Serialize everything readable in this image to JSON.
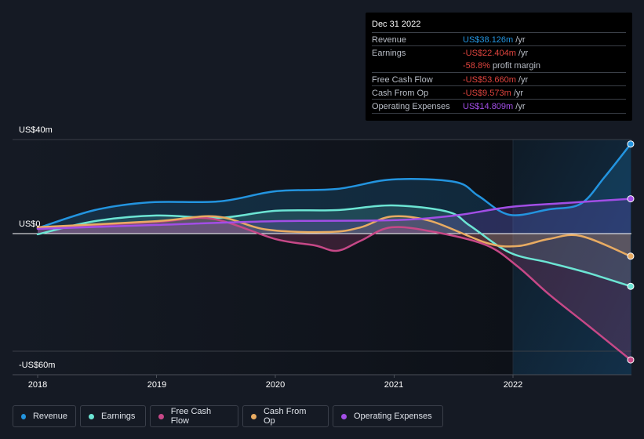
{
  "tooltip": {
    "date": "Dec 31 2022",
    "rows": [
      {
        "label": "Revenue",
        "value": "US$38.126m",
        "unit": " /yr",
        "color": "#2394df"
      },
      {
        "label": "Earnings",
        "value": "-US$22.404m",
        "unit": " /yr",
        "color": "#e0443e"
      },
      {
        "label": "",
        "value": "-58.8%",
        "unit": " profit margin",
        "color": "#e0443e"
      },
      {
        "label": "Free Cash Flow",
        "value": "-US$53.660m",
        "unit": " /yr",
        "color": "#e0443e"
      },
      {
        "label": "Cash From Op",
        "value": "-US$9.573m",
        "unit": " /yr",
        "color": "#e0443e"
      },
      {
        "label": "Operating Expenses",
        "value": "US$14.809m",
        "unit": " /yr",
        "color": "#a24ee6"
      }
    ]
  },
  "legend": [
    {
      "label": "Revenue",
      "color": "#2394df"
    },
    {
      "label": "Earnings",
      "color": "#6ce5d4"
    },
    {
      "label": "Free Cash Flow",
      "color": "#c64887"
    },
    {
      "label": "Cash From Op",
      "color": "#e8ab62"
    },
    {
      "label": "Operating Expenses",
      "color": "#a24ee6"
    }
  ],
  "chart_data": {
    "type": "line",
    "title": "",
    "xlabel": "",
    "ylabel": "",
    "y_tick_labels": [
      "US$40m",
      "US$0",
      "-US$60m"
    ],
    "x_tick_labels": [
      "2018",
      "2019",
      "2020",
      "2021",
      "2022"
    ],
    "xlim": [
      2017.8,
      2023.0
    ],
    "ylim": [
      -60,
      40
    ],
    "unit": "US$m",
    "highlight_range_start": 2022.0,
    "series": [
      {
        "name": "Revenue",
        "color": "#2394df",
        "points": [
          [
            2018.0,
            2.3
          ],
          [
            2018.48,
            10
          ],
          [
            2018.94,
            13.3
          ],
          [
            2019.53,
            13.7
          ],
          [
            2020.0,
            18
          ],
          [
            2020.52,
            19
          ],
          [
            2020.98,
            23
          ],
          [
            2021.51,
            22
          ],
          [
            2021.71,
            16
          ],
          [
            2021.97,
            8
          ],
          [
            2022.3,
            10.3
          ],
          [
            2022.57,
            12.7
          ],
          [
            2022.77,
            24
          ],
          [
            2022.99,
            38.1
          ]
        ]
      },
      {
        "name": "Earnings",
        "color": "#6ce5d4",
        "points": [
          [
            2018.0,
            -0.3
          ],
          [
            2018.48,
            5.3
          ],
          [
            2019.0,
            7.7
          ],
          [
            2019.53,
            6.7
          ],
          [
            2020.0,
            9.7
          ],
          [
            2020.52,
            10
          ],
          [
            2020.98,
            12
          ],
          [
            2021.45,
            9.3
          ],
          [
            2021.64,
            3.3
          ],
          [
            2021.97,
            -8
          ],
          [
            2022.3,
            -12.3
          ],
          [
            2022.63,
            -16.7
          ],
          [
            2022.99,
            -22.4
          ]
        ]
      },
      {
        "name": "Free Cash Flow",
        "color": "#c64887",
        "points": [
          [
            2018.0,
            2.3
          ],
          [
            2019.0,
            5
          ],
          [
            2019.47,
            6.3
          ],
          [
            2020.0,
            -2.3
          ],
          [
            2020.33,
            -5
          ],
          [
            2020.52,
            -7.3
          ],
          [
            2020.72,
            -3
          ],
          [
            2020.98,
            2.7
          ],
          [
            2021.38,
            0.3
          ],
          [
            2021.78,
            -5
          ],
          [
            2022.04,
            -14
          ],
          [
            2022.3,
            -25.7
          ],
          [
            2022.63,
            -39
          ],
          [
            2022.99,
            -53.7
          ]
        ]
      },
      {
        "name": "Cash From Op",
        "color": "#e8ab62",
        "points": [
          [
            2018.0,
            2.7
          ],
          [
            2019.0,
            5.3
          ],
          [
            2019.5,
            7.3
          ],
          [
            2019.93,
            1.7
          ],
          [
            2020.46,
            0.7
          ],
          [
            2020.72,
            2.7
          ],
          [
            2020.98,
            7.3
          ],
          [
            2021.31,
            5.3
          ],
          [
            2021.78,
            -4
          ],
          [
            2022.04,
            -5.3
          ],
          [
            2022.3,
            -2.3
          ],
          [
            2022.57,
            -1
          ],
          [
            2022.99,
            -9.6
          ]
        ]
      },
      {
        "name": "Operating Expenses",
        "color": "#a24ee6",
        "points": [
          [
            2018.0,
            2
          ],
          [
            2019.0,
            3.7
          ],
          [
            2020.0,
            5.3
          ],
          [
            2020.98,
            5.7
          ],
          [
            2021.51,
            7.7
          ],
          [
            2021.97,
            11.3
          ],
          [
            2022.44,
            13
          ],
          [
            2022.99,
            14.8
          ]
        ]
      }
    ]
  }
}
